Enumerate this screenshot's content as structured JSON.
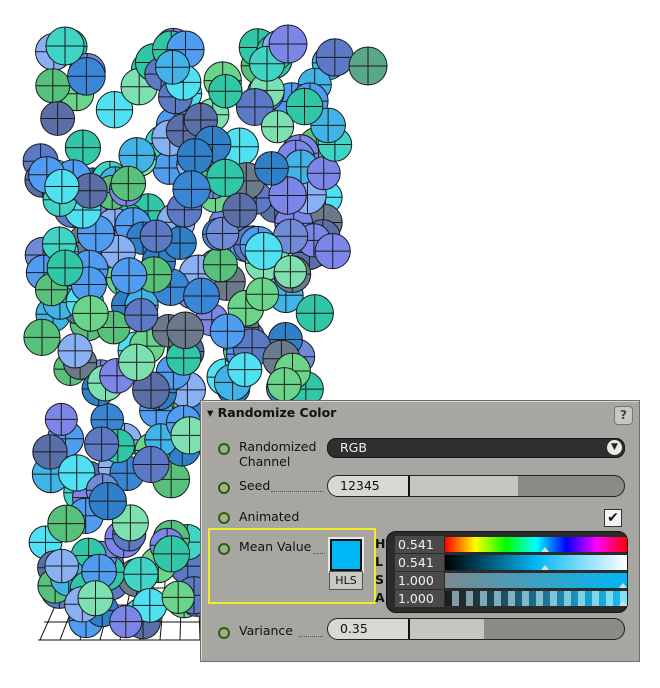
{
  "panel": {
    "title": "Randomize Color",
    "help": "?",
    "randomized_channel": {
      "label_line1": "Randomized",
      "label_line2": "Channel",
      "value": "RGB"
    },
    "seed": {
      "label": "Seed",
      "value": "12345"
    },
    "animated": {
      "label": "Animated",
      "check": "✔"
    },
    "mean_value": {
      "label": "Mean Value",
      "swatch_color": "#00b7f5",
      "mode_button": "HLS",
      "channels": [
        {
          "letter": "H",
          "value": "0.541"
        },
        {
          "letter": "L",
          "value": "0.541"
        },
        {
          "letter": "S",
          "value": "1.000"
        },
        {
          "letter": "A",
          "value": "1.000"
        }
      ]
    },
    "variance": {
      "label": "Variance",
      "value": "0.35"
    }
  },
  "colors": {
    "panel_bg": "#a7a6a0",
    "highlight_box": "#f3ec2a"
  }
}
